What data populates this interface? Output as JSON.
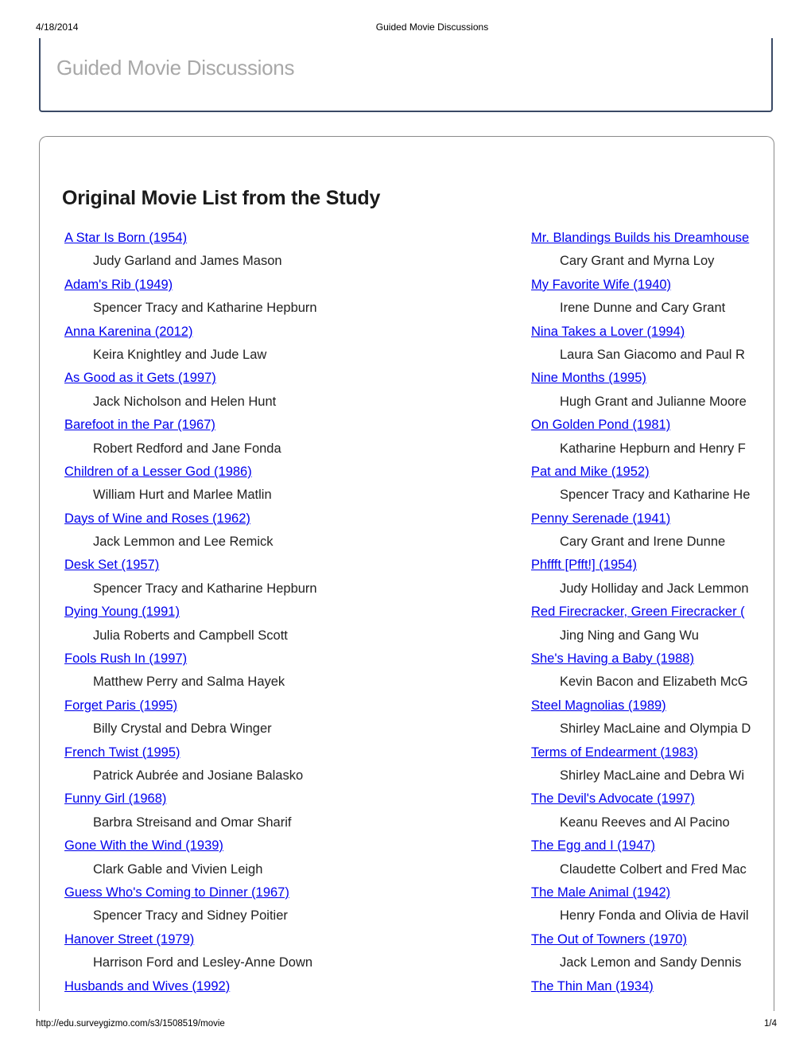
{
  "print_header": {
    "date": "4/18/2014",
    "title": "Guided Movie Discussions"
  },
  "site": {
    "title": "Guided Movie Discussions"
  },
  "section": {
    "title": "Original Movie List from the Study"
  },
  "movies_left": [
    {
      "title": "A Star Is Born (1954)",
      "stars": "Judy Garland and James Mason"
    },
    {
      "title": "Adam's Rib (1949)",
      "stars": "Spencer Tracy and Katharine Hepburn"
    },
    {
      "title": "Anna Karenina (2012)",
      "stars": "Keira Knightley and Jude Law"
    },
    {
      "title": "As Good as it Gets (1997)",
      "stars": "Jack Nicholson and Helen Hunt"
    },
    {
      "title": "Barefoot in the Par (1967)",
      "stars": "Robert Redford and Jane Fonda"
    },
    {
      "title": "Children of a Lesser God (1986)",
      "stars": "William Hurt and Marlee Matlin"
    },
    {
      "title": "Days of Wine and Roses (1962)",
      "stars": "Jack Lemmon and Lee Remick"
    },
    {
      "title": "Desk Set (1957)",
      "stars": "Spencer Tracy and Katharine Hepburn"
    },
    {
      "title": "Dying Young (1991)",
      "stars": "Julia Roberts and Campbell Scott"
    },
    {
      "title": "Fools Rush In (1997)",
      "stars": "Matthew Perry and Salma Hayek"
    },
    {
      "title": "Forget Paris (1995)",
      "stars": "Billy Crystal and Debra Winger"
    },
    {
      "title": "French Twist (1995)",
      "stars": "Patrick Aubrée and Josiane Balasko"
    },
    {
      "title": "Funny Girl (1968)",
      "stars": "Barbra Streisand and Omar Sharif"
    },
    {
      "title": "Gone With the Wind (1939)",
      "stars": "Clark Gable and Vivien Leigh"
    },
    {
      "title": "Guess Who's Coming to Dinner (1967)",
      "stars": "Spencer Tracy and Sidney Poitier"
    },
    {
      "title": "Hanover Street (1979)",
      "stars": "Harrison Ford and Lesley-Anne Down"
    },
    {
      "title": "Husbands and Wives (1992)",
      "stars": ""
    }
  ],
  "movies_right": [
    {
      "title": "Mr. Blandings Builds his Dreamhouse",
      "stars": "Cary Grant and Myrna Loy"
    },
    {
      "title": "My Favorite Wife (1940)",
      "stars": "Irene Dunne and Cary Grant"
    },
    {
      "title": "Nina Takes a Lover (1994)",
      "stars": "Laura San Giacomo and Paul R"
    },
    {
      "title": "Nine Months (1995)",
      "stars": "Hugh Grant and Julianne Moore"
    },
    {
      "title": "On Golden Pond (1981)",
      "stars": "Katharine Hepburn and Henry F"
    },
    {
      "title": "Pat and Mike (1952)",
      "stars": "Spencer Tracy and Katharine He"
    },
    {
      "title": "Penny Serenade (1941)",
      "stars": "Cary Grant and Irene Dunne"
    },
    {
      "title": "Phffft [Pfft!] (1954)",
      "stars": "Judy Holliday and Jack Lemmon"
    },
    {
      "title": "Red Firecracker, Green Firecracker (",
      "stars": "Jing Ning and Gang Wu"
    },
    {
      "title": "She's Having a Baby (1988)",
      "stars": "Kevin Bacon and Elizabeth McG"
    },
    {
      "title": "Steel Magnolias (1989)",
      "stars": "Shirley MacLaine and Olympia D"
    },
    {
      "title": "Terms of Endearment (1983)",
      "stars": "Shirley MacLaine and Debra Wi"
    },
    {
      "title": "The Devil's Advocate (1997)",
      "stars": "Keanu Reeves and Al Pacino"
    },
    {
      "title": "The Egg and I (1947)",
      "stars": "Claudette Colbert and Fred Mac"
    },
    {
      "title": "The Male Animal (1942)",
      "stars": "Henry Fonda and Olivia de Havil"
    },
    {
      "title": "The Out of Towners (1970)",
      "stars": "Jack Lemon and Sandy Dennis"
    },
    {
      "title": "The Thin Man (1934)",
      "stars": ""
    }
  ],
  "print_footer": {
    "url": "http://edu.surveygizmo.com/s3/1508519/movie",
    "page": "1/4"
  },
  "colors": {
    "link": "#0000ee",
    "site_title": "#a8a8a8",
    "card_border": "#3a4a66"
  }
}
